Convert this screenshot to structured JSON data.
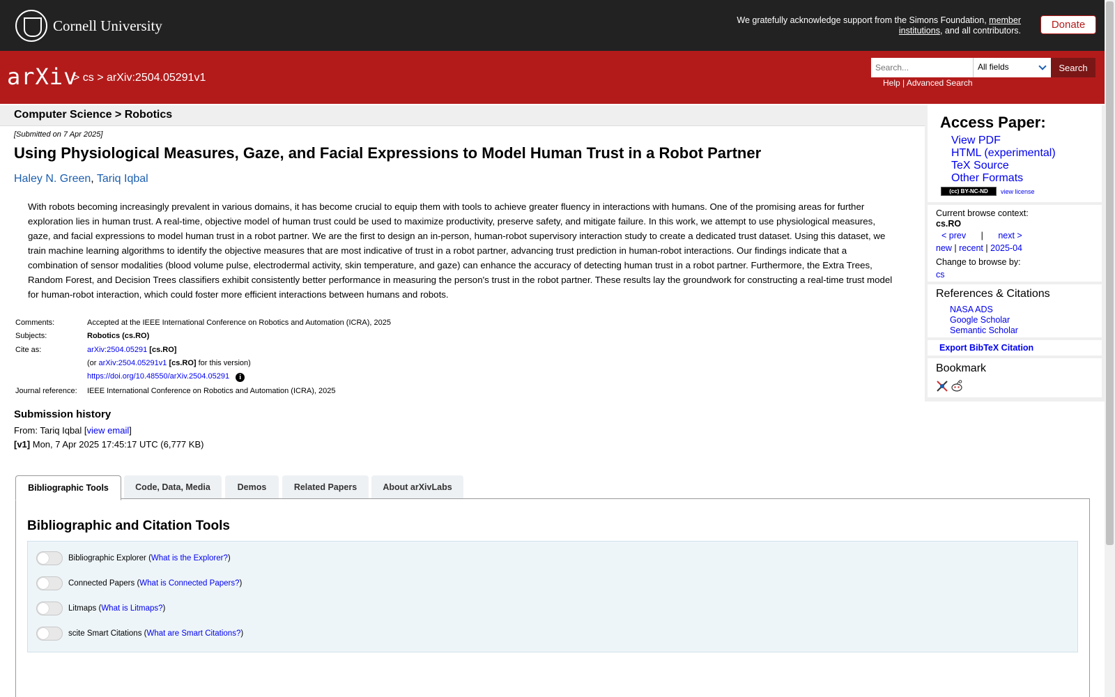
{
  "header": {
    "institution": "Cornell University",
    "support_text_1": "We gratefully acknowledge support from the Simons Foundation,",
    "support_link": "member institutions",
    "support_text_2": ", and all contributors.",
    "donate_label": "Donate"
  },
  "nav": {
    "logo_text": "arXiv",
    "breadcrumb": "> cs > arXiv:2504.05291v1",
    "search_placeholder": "Search...",
    "search_field": "All fields",
    "search_button": "Search",
    "help_link": "Help",
    "separator": "|",
    "advanced_link": "Advanced Search"
  },
  "category": "Computer Science > Robotics",
  "paper": {
    "submitted": "[Submitted on 7 Apr 2025]",
    "title": "Using Physiological Measures, Gaze, and Facial Expressions to Model Human Trust in a Robot Partner",
    "authors": [
      "Haley N. Green",
      "Tariq Iqbal"
    ],
    "author_sep": ",",
    "abstract": "With robots becoming increasingly prevalent in various domains, it has become crucial to equip them with tools to achieve greater fluency in interactions with humans. One of the promising areas for further exploration lies in human trust. A real-time, objective model of human trust could be used to maximize productivity, preserve safety, and mitigate failure. In this work, we attempt to use physiological measures, gaze, and facial expressions to model human trust in a robot partner. We are the first to design an in-person, human-robot supervisory interaction study to create a dedicated trust dataset. Using this dataset, we train machine learning algorithms to identify the objective measures that are most indicative of trust in a robot partner, advancing trust prediction in human-robot interactions. Our findings indicate that a combination of sensor modalities (blood volume pulse, electrodermal activity, skin temperature, and gaze) can enhance the accuracy of detecting human trust in a robot partner. Furthermore, the Extra Trees, Random Forest, and Decision Trees classifiers exhibit consistently better performance in measuring the person's trust in the robot partner. These results lay the groundwork for constructing a real-time trust model for human-robot interaction, which could foster more efficient interactions between humans and robots."
  },
  "meta": {
    "comments_label": "Comments:",
    "comments": "Accepted at the IEEE International Conference on Robotics and Automation (ICRA), 2025",
    "subjects_label": "Subjects:",
    "subjects": "Robotics (cs.RO)",
    "cite_label": "Cite as:",
    "cite_id": "arXiv:2504.05291",
    "cite_cat": "[cs.RO]",
    "or_prefix": "(or",
    "version_id": "arXiv:2504.05291v1",
    "version_cat": "[cs.RO]",
    "version_suffix": "for this version)",
    "doi": "https://doi.org/10.48550/arXiv.2504.05291",
    "info_glyph": "i",
    "journal_label": "Journal reference:",
    "journal": "IEEE International Conference on Robotics and Automation (ICRA), 2025"
  },
  "history": {
    "title": "Submission history",
    "from_prefix": "From: Tariq Iqbal [",
    "view_email": "view email",
    "from_suffix": "]",
    "v1_label": "[v1]",
    "v1_text": "Mon, 7 Apr 2025 17:45:17 UTC (6,777 KB)"
  },
  "tabs": [
    "Bibliographic Tools",
    "Code, Data, Media",
    "Demos",
    "Related Papers",
    "About arXivLabs"
  ],
  "panel": {
    "title": "Bibliographic and Citation Tools",
    "tools": [
      {
        "label": "Bibliographic Explorer",
        "link": "What is the Explorer?"
      },
      {
        "label": "Connected Papers",
        "link": "What is Connected Papers?"
      },
      {
        "label": "Litmaps",
        "link": "What is Litmaps?"
      },
      {
        "label": "scite Smart Citations",
        "link": "What are Smart Citations?"
      }
    ]
  },
  "sidebar": {
    "access_title": "Access Paper:",
    "access_links": [
      "View PDF",
      "HTML (experimental)",
      "TeX Source",
      "Other Formats"
    ],
    "license_badge": "(cc) BY-NC-ND",
    "view_license": "view license",
    "context_label": "Current browse context:",
    "context_value": "cs.RO",
    "prev": "< prev",
    "pipe": "|",
    "next": "next >",
    "new": "new",
    "recent": "recent",
    "month": "2025-04",
    "change_label": "Change to browse by:",
    "change_value": "cs",
    "refs_title": "References & Citations",
    "refs_links": [
      "NASA ADS",
      "Google Scholar",
      "Semantic Scholar"
    ],
    "export": "Export BibTeX Citation",
    "bookmark": "Bookmark"
  },
  "colors": {
    "arxiv_red": "#b31b1b",
    "top_bar": "#222222",
    "link_blue": "#0000ee"
  }
}
